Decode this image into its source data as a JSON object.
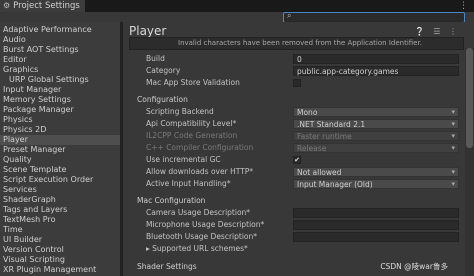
{
  "window": {
    "tab_title": "Project Settings"
  },
  "sidebar": {
    "items": [
      {
        "label": "Adaptive Performance",
        "child": false,
        "selected": false
      },
      {
        "label": "Audio",
        "child": false,
        "selected": false
      },
      {
        "label": "Burst AOT Settings",
        "child": false,
        "selected": false
      },
      {
        "label": "Editor",
        "child": false,
        "selected": false
      },
      {
        "label": "Graphics",
        "child": false,
        "selected": false
      },
      {
        "label": "URP Global Settings",
        "child": true,
        "selected": false
      },
      {
        "label": "Input Manager",
        "child": false,
        "selected": false
      },
      {
        "label": "Memory Settings",
        "child": false,
        "selected": false
      },
      {
        "label": "Package Manager",
        "child": false,
        "selected": false
      },
      {
        "label": "Physics",
        "child": false,
        "selected": false
      },
      {
        "label": "Physics 2D",
        "child": false,
        "selected": false
      },
      {
        "label": "Player",
        "child": false,
        "selected": true
      },
      {
        "label": "Preset Manager",
        "child": false,
        "selected": false
      },
      {
        "label": "Quality",
        "child": false,
        "selected": false
      },
      {
        "label": "Scene Template",
        "child": false,
        "selected": false
      },
      {
        "label": "Script Execution Order",
        "child": false,
        "selected": false
      },
      {
        "label": "Services",
        "child": false,
        "selected": false
      },
      {
        "label": "ShaderGraph",
        "child": false,
        "selected": false
      },
      {
        "label": "Tags and Layers",
        "child": false,
        "selected": false
      },
      {
        "label": "TextMesh Pro",
        "child": false,
        "selected": false
      },
      {
        "label": "Time",
        "child": false,
        "selected": false
      },
      {
        "label": "UI Builder",
        "child": false,
        "selected": false
      },
      {
        "label": "Version Control",
        "child": false,
        "selected": false
      },
      {
        "label": "Visual Scripting",
        "child": false,
        "selected": false
      },
      {
        "label": "XR Plugin Management",
        "child": false,
        "selected": false
      }
    ]
  },
  "main": {
    "title": "Player",
    "warning": "Invalid characters have been removed from the Application Identifier.",
    "rows": {
      "build": {
        "label": "Build",
        "value": "0"
      },
      "category": {
        "label": "Category",
        "value": "public.app-category.games"
      },
      "mac_app_store": {
        "label": "Mac App Store Validation"
      },
      "configuration": "Configuration",
      "scripting_backend": {
        "label": "Scripting Backend",
        "value": "Mono"
      },
      "api_level": {
        "label": "Api Compatibility Level*",
        "value": ".NET Standard 2.1"
      },
      "il2cpp_gen": {
        "label": "IL2CPP Code Generation",
        "value": "Faster runtime"
      },
      "cpp_config": {
        "label": "C++ Compiler Configuration",
        "value": "Release"
      },
      "incremental_gc": {
        "label": "Use incremental GC",
        "checked": "✔"
      },
      "allow_http": {
        "label": "Allow downloads over HTTP*",
        "value": "Not allowed"
      },
      "active_input": {
        "label": "Active Input Handling*",
        "value": "Input Manager (Old)"
      },
      "mac_config": "Mac Configuration",
      "camera_usage": {
        "label": "Camera Usage Description*"
      },
      "mic_usage": {
        "label": "Microphone Usage Description*"
      },
      "bt_usage": {
        "label": "Bluetooth Usage Description*"
      },
      "url_schemes": {
        "label": "▸ Supported URL schemes*"
      },
      "shader_settings": "Shader Settings"
    }
  },
  "watermark": "CSDN @陵war鲁多"
}
